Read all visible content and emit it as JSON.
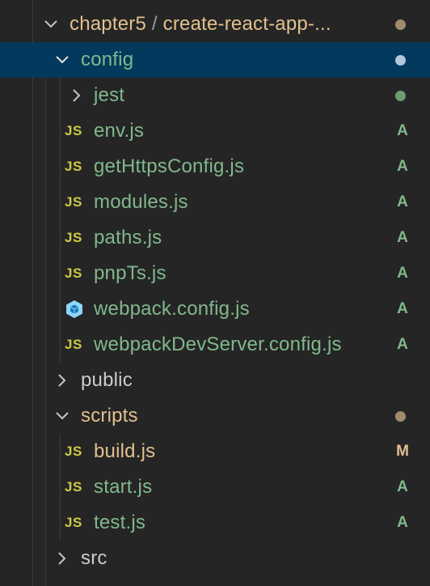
{
  "colors": {
    "modified": "#e2c08d",
    "added": "#81b88b",
    "folder_text": "#cccccc",
    "js_icon": "#cbcb41",
    "selection": "#04395e",
    "dot_modified": "#a08c6c",
    "dot_added": "#6f9a72",
    "dot_selected": "#b4c7dc"
  },
  "header": {
    "parent": "chapter5",
    "separator": "/",
    "folder": "create-react-app-...",
    "icon": "chevron-down-icon",
    "decoration": "dot"
  },
  "tree": {
    "config": {
      "label": "config",
      "icon": "chevron-down-icon",
      "decoration": "dot",
      "selected": true
    },
    "jest": {
      "label": "jest",
      "icon": "chevron-right-icon",
      "decoration": "dot"
    },
    "env": {
      "label": "env.js",
      "icon_text": "JS",
      "badge": "A"
    },
    "getHttpsConfig": {
      "label": "getHttpsConfig.js",
      "icon_text": "JS",
      "badge": "A"
    },
    "modules": {
      "label": "modules.js",
      "icon_text": "JS",
      "badge": "A"
    },
    "paths": {
      "label": "paths.js",
      "icon_text": "JS",
      "badge": "A"
    },
    "pnpTs": {
      "label": "pnpTs.js",
      "icon_text": "JS",
      "badge": "A"
    },
    "webpackConfig": {
      "label": "webpack.config.js",
      "icon": "webpack-icon",
      "badge": "A"
    },
    "webpackDevServer": {
      "label": "webpackDevServer.config.js",
      "icon_text": "JS",
      "badge": "A"
    },
    "public": {
      "label": "public",
      "icon": "chevron-right-icon"
    },
    "scripts": {
      "label": "scripts",
      "icon": "chevron-down-icon",
      "decoration": "dot"
    },
    "build": {
      "label": "build.js",
      "icon_text": "JS",
      "badge": "M"
    },
    "start": {
      "label": "start.js",
      "icon_text": "JS",
      "badge": "A"
    },
    "test": {
      "label": "test.js",
      "icon_text": "JS",
      "badge": "A"
    },
    "src": {
      "label": "src",
      "icon": "chevron-right-icon"
    }
  }
}
